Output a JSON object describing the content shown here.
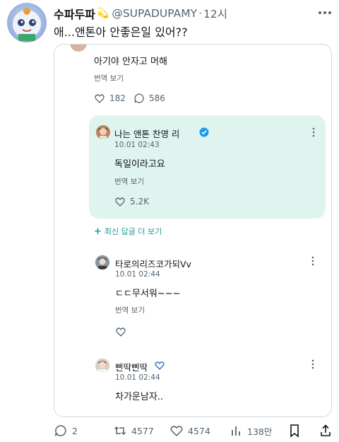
{
  "author": {
    "name": "수파두파",
    "emoji": "💫",
    "handle": "@SUPADUPAMY",
    "separator": "·",
    "time": "12시"
  },
  "tweet_text": "애...앤톤아 안좋은일 있어??",
  "card": {
    "comment1": {
      "text": "아기야 안자고 머해",
      "translate": "번역 보기",
      "likes": "182",
      "replies": "586"
    },
    "reply_highlight": {
      "name": "나는 앤톤 찬영 리",
      "timestamp": "10.01 02:43",
      "text": "독일이라고요",
      "translate": "번역 보기",
      "likes": "5.2K"
    },
    "more_replies": "최신 답글 더 보기",
    "comment2": {
      "name": "타로의리즈코가되Vv",
      "timestamp": "10.01 02:44",
      "text": "ㄷㄷ무서워~~~",
      "translate": "번역 보기"
    },
    "comment3": {
      "name": "삔딱삔딱",
      "timestamp": "10.01 02:44",
      "text": "차가운남자.."
    }
  },
  "actions": {
    "reply": "2",
    "retweet": "4577",
    "like": "4574",
    "views": "138만"
  },
  "colors": {
    "teal_bg": "#dff3ef",
    "verified": "#1d9bf0",
    "gray_text": "#536471",
    "plus_accent": "#1d9b8e"
  }
}
